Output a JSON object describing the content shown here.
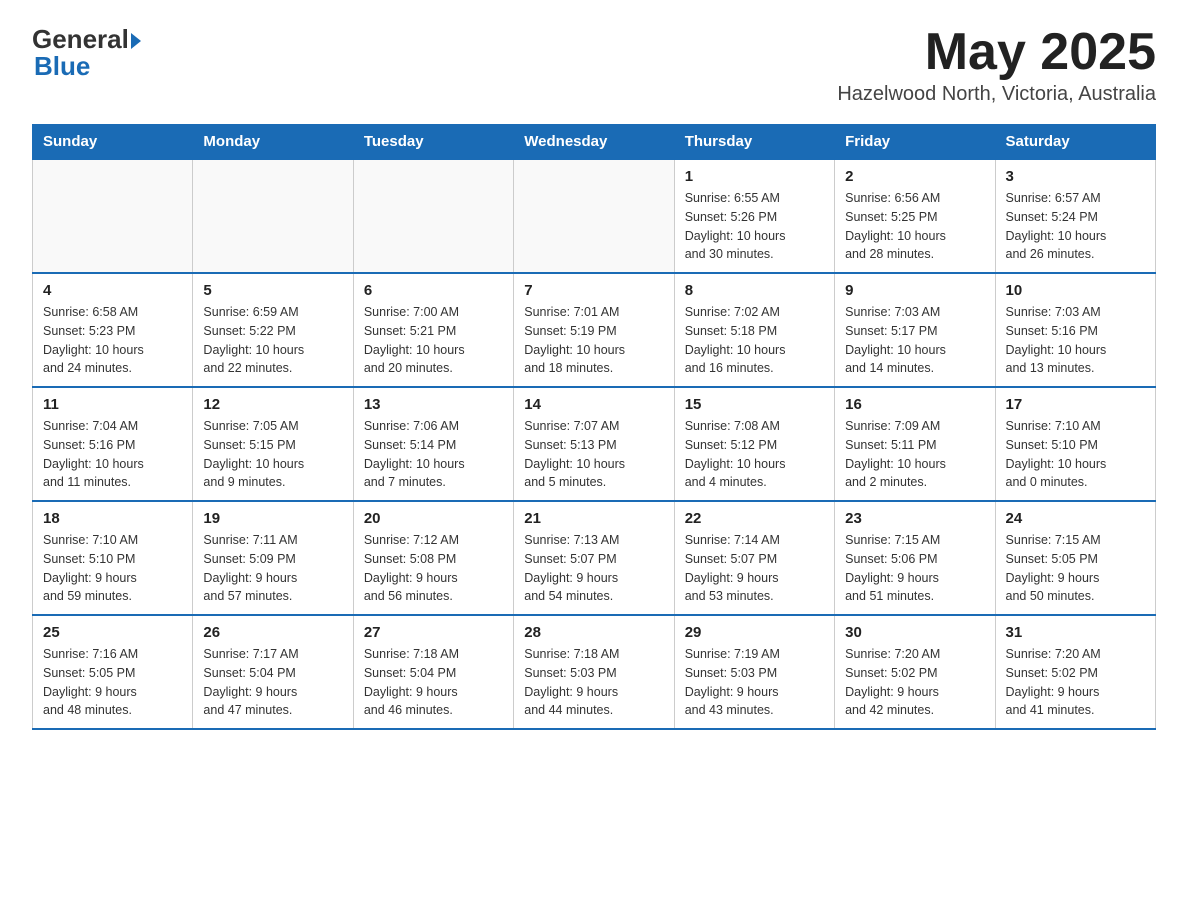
{
  "header": {
    "logo_general": "General",
    "logo_blue": "Blue",
    "month_title": "May 2025",
    "location": "Hazelwood North, Victoria, Australia"
  },
  "weekdays": [
    "Sunday",
    "Monday",
    "Tuesday",
    "Wednesday",
    "Thursday",
    "Friday",
    "Saturday"
  ],
  "weeks": [
    [
      {
        "num": "",
        "info": ""
      },
      {
        "num": "",
        "info": ""
      },
      {
        "num": "",
        "info": ""
      },
      {
        "num": "",
        "info": ""
      },
      {
        "num": "1",
        "info": "Sunrise: 6:55 AM\nSunset: 5:26 PM\nDaylight: 10 hours\nand 30 minutes."
      },
      {
        "num": "2",
        "info": "Sunrise: 6:56 AM\nSunset: 5:25 PM\nDaylight: 10 hours\nand 28 minutes."
      },
      {
        "num": "3",
        "info": "Sunrise: 6:57 AM\nSunset: 5:24 PM\nDaylight: 10 hours\nand 26 minutes."
      }
    ],
    [
      {
        "num": "4",
        "info": "Sunrise: 6:58 AM\nSunset: 5:23 PM\nDaylight: 10 hours\nand 24 minutes."
      },
      {
        "num": "5",
        "info": "Sunrise: 6:59 AM\nSunset: 5:22 PM\nDaylight: 10 hours\nand 22 minutes."
      },
      {
        "num": "6",
        "info": "Sunrise: 7:00 AM\nSunset: 5:21 PM\nDaylight: 10 hours\nand 20 minutes."
      },
      {
        "num": "7",
        "info": "Sunrise: 7:01 AM\nSunset: 5:19 PM\nDaylight: 10 hours\nand 18 minutes."
      },
      {
        "num": "8",
        "info": "Sunrise: 7:02 AM\nSunset: 5:18 PM\nDaylight: 10 hours\nand 16 minutes."
      },
      {
        "num": "9",
        "info": "Sunrise: 7:03 AM\nSunset: 5:17 PM\nDaylight: 10 hours\nand 14 minutes."
      },
      {
        "num": "10",
        "info": "Sunrise: 7:03 AM\nSunset: 5:16 PM\nDaylight: 10 hours\nand 13 minutes."
      }
    ],
    [
      {
        "num": "11",
        "info": "Sunrise: 7:04 AM\nSunset: 5:16 PM\nDaylight: 10 hours\nand 11 minutes."
      },
      {
        "num": "12",
        "info": "Sunrise: 7:05 AM\nSunset: 5:15 PM\nDaylight: 10 hours\nand 9 minutes."
      },
      {
        "num": "13",
        "info": "Sunrise: 7:06 AM\nSunset: 5:14 PM\nDaylight: 10 hours\nand 7 minutes."
      },
      {
        "num": "14",
        "info": "Sunrise: 7:07 AM\nSunset: 5:13 PM\nDaylight: 10 hours\nand 5 minutes."
      },
      {
        "num": "15",
        "info": "Sunrise: 7:08 AM\nSunset: 5:12 PM\nDaylight: 10 hours\nand 4 minutes."
      },
      {
        "num": "16",
        "info": "Sunrise: 7:09 AM\nSunset: 5:11 PM\nDaylight: 10 hours\nand 2 minutes."
      },
      {
        "num": "17",
        "info": "Sunrise: 7:10 AM\nSunset: 5:10 PM\nDaylight: 10 hours\nand 0 minutes."
      }
    ],
    [
      {
        "num": "18",
        "info": "Sunrise: 7:10 AM\nSunset: 5:10 PM\nDaylight: 9 hours\nand 59 minutes."
      },
      {
        "num": "19",
        "info": "Sunrise: 7:11 AM\nSunset: 5:09 PM\nDaylight: 9 hours\nand 57 minutes."
      },
      {
        "num": "20",
        "info": "Sunrise: 7:12 AM\nSunset: 5:08 PM\nDaylight: 9 hours\nand 56 minutes."
      },
      {
        "num": "21",
        "info": "Sunrise: 7:13 AM\nSunset: 5:07 PM\nDaylight: 9 hours\nand 54 minutes."
      },
      {
        "num": "22",
        "info": "Sunrise: 7:14 AM\nSunset: 5:07 PM\nDaylight: 9 hours\nand 53 minutes."
      },
      {
        "num": "23",
        "info": "Sunrise: 7:15 AM\nSunset: 5:06 PM\nDaylight: 9 hours\nand 51 minutes."
      },
      {
        "num": "24",
        "info": "Sunrise: 7:15 AM\nSunset: 5:05 PM\nDaylight: 9 hours\nand 50 minutes."
      }
    ],
    [
      {
        "num": "25",
        "info": "Sunrise: 7:16 AM\nSunset: 5:05 PM\nDaylight: 9 hours\nand 48 minutes."
      },
      {
        "num": "26",
        "info": "Sunrise: 7:17 AM\nSunset: 5:04 PM\nDaylight: 9 hours\nand 47 minutes."
      },
      {
        "num": "27",
        "info": "Sunrise: 7:18 AM\nSunset: 5:04 PM\nDaylight: 9 hours\nand 46 minutes."
      },
      {
        "num": "28",
        "info": "Sunrise: 7:18 AM\nSunset: 5:03 PM\nDaylight: 9 hours\nand 44 minutes."
      },
      {
        "num": "29",
        "info": "Sunrise: 7:19 AM\nSunset: 5:03 PM\nDaylight: 9 hours\nand 43 minutes."
      },
      {
        "num": "30",
        "info": "Sunrise: 7:20 AM\nSunset: 5:02 PM\nDaylight: 9 hours\nand 42 minutes."
      },
      {
        "num": "31",
        "info": "Sunrise: 7:20 AM\nSunset: 5:02 PM\nDaylight: 9 hours\nand 41 minutes."
      }
    ]
  ]
}
